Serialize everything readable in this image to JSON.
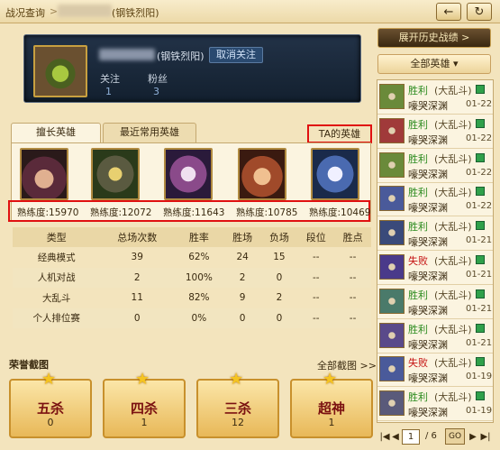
{
  "header": {
    "crumb_root": "战况查询",
    "crumb_sep": ">",
    "crumb_title": "(钢铁烈阳)",
    "back_icon": "←",
    "refresh_icon": "↻"
  },
  "profile": {
    "region": "(钢铁烈阳)",
    "unfollow": "取消关注",
    "follow_label": "关注",
    "follow_count": "1",
    "fans_label": "粉丝",
    "fans_count": "3"
  },
  "tabs": {
    "tab1": "擅长英雄",
    "tab2": "最近常用英雄",
    "ta_link": "TA的英雄 >>"
  },
  "mastery": [
    "熟练度:15970",
    "熟练度:12072",
    "熟练度:11643",
    "熟练度:10785",
    "熟练度:10469"
  ],
  "stats": {
    "headers": [
      "类型",
      "总场次数",
      "胜率",
      "胜场",
      "负场",
      "段位",
      "胜点"
    ],
    "rows": [
      [
        "经典模式",
        "39",
        "62%",
        "24",
        "15",
        "--",
        "--"
      ],
      [
        "人机对战",
        "2",
        "100%",
        "2",
        "0",
        "--",
        "--"
      ],
      [
        "大乱斗",
        "11",
        "82%",
        "9",
        "2",
        "--",
        "--"
      ],
      [
        "个人排位赛",
        "0",
        "0%",
        "0",
        "0",
        "--",
        "--"
      ]
    ]
  },
  "honor": {
    "title": "荣誉截图",
    "all": "全部截图 >>",
    "badges": [
      {
        "name": "五杀",
        "count": "0"
      },
      {
        "name": "四杀",
        "count": "1"
      },
      {
        "name": "三杀",
        "count": "12"
      },
      {
        "name": "超神",
        "count": "1"
      }
    ]
  },
  "side": {
    "history_button": "展开历史战绩 >",
    "filter": "全部英雄 ▾",
    "matches": [
      {
        "result": "胜利",
        "mode": "(大乱斗)",
        "map": "嚎哭深渊",
        "date": "01-22"
      },
      {
        "result": "胜利",
        "mode": "(大乱斗)",
        "map": "嚎哭深渊",
        "date": "01-22"
      },
      {
        "result": "胜利",
        "mode": "(大乱斗)",
        "map": "嚎哭深渊",
        "date": "01-22"
      },
      {
        "result": "胜利",
        "mode": "(大乱斗)",
        "map": "嚎哭深渊",
        "date": "01-22"
      },
      {
        "result": "胜利",
        "mode": "(大乱斗)",
        "map": "嚎哭深渊",
        "date": "01-21"
      },
      {
        "result": "失败",
        "mode": "(大乱斗)",
        "map": "嚎哭深渊",
        "date": "01-21"
      },
      {
        "result": "胜利",
        "mode": "(大乱斗)",
        "map": "嚎哭深渊",
        "date": "01-21"
      },
      {
        "result": "胜利",
        "mode": "(大乱斗)",
        "map": "嚎哭深渊",
        "date": "01-21"
      },
      {
        "result": "失败",
        "mode": "(大乱斗)",
        "map": "嚎哭深渊",
        "date": "01-19"
      },
      {
        "result": "胜利",
        "mode": "(大乱斗)",
        "map": "嚎哭深渊",
        "date": "01-19"
      }
    ],
    "pager": {
      "first": "|◀",
      "prev": "◀",
      "current": "1",
      "total": "/ 6",
      "go": "GO",
      "next": "▶",
      "last": "▶|"
    }
  },
  "colors": {
    "win": "#2b8a1e",
    "loss": "#c41010",
    "accent_red": "#e01010",
    "gold": "#c8a040"
  }
}
